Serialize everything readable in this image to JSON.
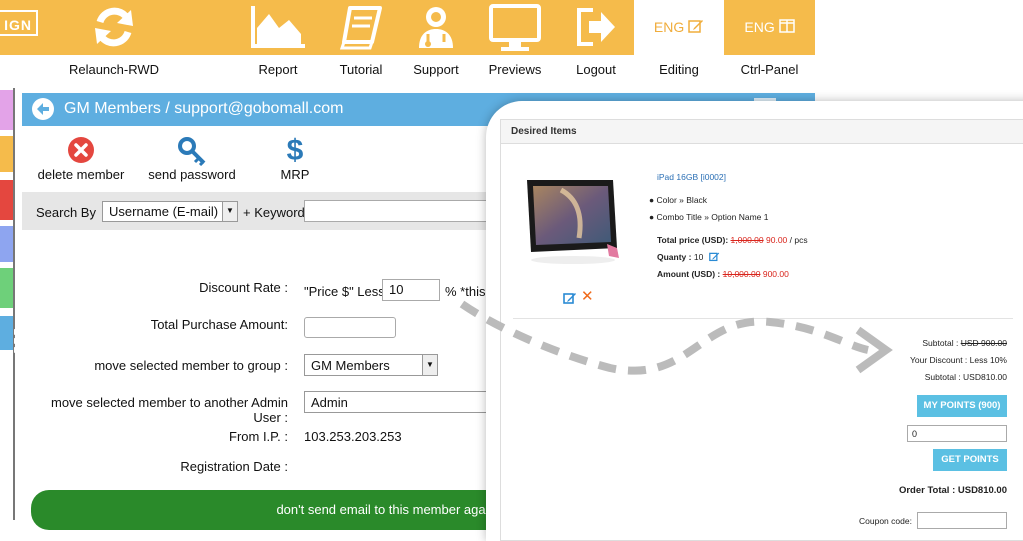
{
  "topnav": {
    "logo_fragment": "IGN",
    "items": [
      {
        "label": "Relaunch-RWD",
        "icon": "refresh-icon"
      },
      {
        "label": "Report",
        "icon": "chart-icon"
      },
      {
        "label": "Tutorial",
        "icon": "book-icon"
      },
      {
        "label": "Support",
        "icon": "support-person-icon"
      },
      {
        "label": "Previews",
        "icon": "monitor-icon"
      },
      {
        "label": "Logout",
        "icon": "logout-icon"
      }
    ],
    "lang_editing": {
      "label": "ENG",
      "sublabel": "Editing",
      "icon": "edit-icon"
    },
    "lang_ctrl": {
      "label": "ENG",
      "sublabel": "Ctrl-Panel",
      "icon": "panel-icon"
    }
  },
  "panel": {
    "title": "GM Members / support@gobomall.com",
    "actions": [
      {
        "label": "delete member",
        "icon": "delete-icon"
      },
      {
        "label": "send password",
        "icon": "key-icon"
      },
      {
        "label": "MRP",
        "icon": "dollar-icon"
      }
    ],
    "search": {
      "search_by_label": "Search By",
      "search_by_value": "Username (E-mail)",
      "keyword_label": "+ Keyword",
      "keyword_value": ""
    },
    "form": {
      "discount_label": "Discount Rate :",
      "discount_prefix": "\"Price $\" Less",
      "discount_value": "10",
      "discount_suffix": "% *this",
      "total_purchase_label": "Total Purchase Amount:",
      "total_purchase_value": "",
      "group_label": "move selected member to group :",
      "group_value": "GM Members",
      "admin_label": "move selected member to another Admin User :",
      "admin_value": "Admin",
      "ip_label": "From I.P. :",
      "ip_value": "103.253.203.253",
      "reg_label": "Registration Date :"
    },
    "no_email_button": "don't send email to this member again : Y"
  },
  "card": {
    "title": "Desired Items",
    "product_name": "iPad 16GB [i0002]",
    "option_color": "Color » Black",
    "option_combo": "Combo Title » Option Name 1",
    "total_price_label": "Total price (USD):",
    "total_price_old": "1,000.00",
    "total_price_new": "90.00",
    "total_price_unit": "/ pcs",
    "quantity_label": "Quanty :",
    "quantity_value": "10",
    "amount_label": "Amount (USD) :",
    "amount_old": "10,000.00",
    "amount_new": "900.00",
    "subtotal_label": "Subtotal :",
    "subtotal_old": "USD 900.00",
    "discount_text": "Your Discount : Less 10%",
    "subtotal2_text": "Subtotal : USD810.00",
    "my_points_button": "MY POINTS (900)",
    "points_input_value": "0",
    "get_points_button": "GET POINTS",
    "order_total_text": "Order Total : USD810.00",
    "coupon_label": "Coupon code:"
  },
  "colors": {
    "nav_orange": "#f5bb4b",
    "panel_blue": "#5eaee0",
    "green": "#2a8a2a",
    "price_red": "#d9251c",
    "points_blue": "#5bc0e3"
  }
}
